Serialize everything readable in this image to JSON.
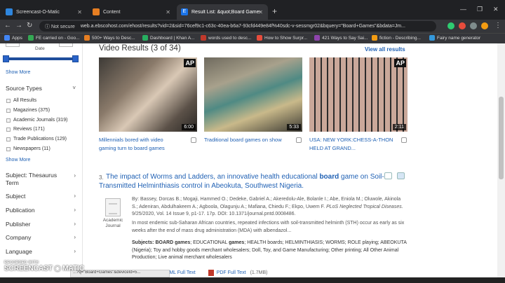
{
  "browser": {
    "tabs": [
      {
        "title": "Screencast-O-Matic",
        "color": "#2e86de"
      },
      {
        "title": "Content",
        "color": "#e67e22"
      },
      {
        "title": "Result List: &quot;Board Games&",
        "color": "#1a73e8"
      }
    ],
    "new_tab": "+",
    "security": "Not secure",
    "url": "web.a.ebscohost.com/ehost/results?vid=2&sid=76cef9c1-c63c-40ea-b6a7-93cfd449e84f%40sdc-v-sessmgr02&bquery=\"Board+Games\"&bdata=Jm...",
    "bookmarks": [
      "Apps",
      "FE carried on - Goo...",
      "500+ Ways to Desc...",
      "Dashboard | Khan A...",
      "words used to desc...",
      "How to Show Surpr...",
      "421 Ways to Say Sai...",
      "fiction - Describing...",
      "Fairy name generator"
    ]
  },
  "sidebar": {
    "date_label": "Date",
    "show_more": "Show More",
    "source_types": {
      "title": "Source Types",
      "items": [
        "All Results",
        "Magazines (375)",
        "Academic Journals (319)",
        "Reviews (171)",
        "Trade Publications (129)",
        "Newspapers (11)"
      ]
    },
    "sections": [
      "Subject: Thesaurus Term",
      "Subject",
      "Publication",
      "Publisher",
      "Company",
      "Language"
    ]
  },
  "videos": {
    "title": "Video Results (3 of 34)",
    "view_all": "View all results",
    "items": [
      {
        "caption": "Millennials bored with video gaming turn to board games",
        "duration": "6:00",
        "ap": "AP"
      },
      {
        "caption": "Traditional board games on show",
        "duration": "5:33",
        "ap": ""
      },
      {
        "caption": "USA: NEW YORK:CHESS-A-THON HELD AT GRAND...",
        "duration": "2:11",
        "ap": "AP"
      }
    ]
  },
  "result": {
    "number": "3.",
    "title_pre": "The impact of Worms and Ladders, an innovative health educational",
    "title_bold": "board",
    "title_post": "game on Soil-Transmitted Helminthiasis control in Abeokuta, Southwest Nigeria.",
    "doc_type": "Academic Journal",
    "authors": "By: Bassey, Dorcas B.; Mogaji, Hammed O.; Dedeke, Gabriel A.; Akeredolu-Ale, Bolanle I.; Abe, Eniola M.; Oluwole, Akinola S.; Adeniran, Abdulhakeem A.; Agboola, Olagunju A.; Mafiana, Chiedu F.; Ekpo, Uwem F.",
    "journal": "PLoS Neglected Tropical Diseases.",
    "citation": "9/25/2020, Vol. 14 Issue 9, p1-17. 17p. DOI: 10.1371/journal.pntd.0008486.",
    "abstract": "In most endemic sub-Saharan African countries, repeated infections with soil-transmitted helminth (STH) occur as early as six weeks after the end of mass drug administration (MDA) with albendazol...",
    "subjects_label": "Subjects:",
    "subjects_bold1": "BOARD games",
    "subjects_mid": "; EDUCATIONAL",
    "subjects_bold2": "games",
    "subjects_rest": "; HEALTH boards; HELMINTHIASIS; WORMS; ROLE playing; ABEOKUTA (Nigeria); Toy and hobby goods merchant wholesalers; Doll, Toy, and Game Manufacturing; Other printing; All Other Animal Production; Live animal merchant wholesalers",
    "html_link": "HTML Full Text",
    "pdf_link": "PDF Full Text",
    "pdf_size": "(1.7MB)"
  },
  "overlay": {
    "recorded_with": "RECORDED WITH",
    "brand": "SCREENCAST",
    "brand2": "MATIC",
    "status_url": "...?q=\"Board+Games\"&deviceId=5..."
  }
}
